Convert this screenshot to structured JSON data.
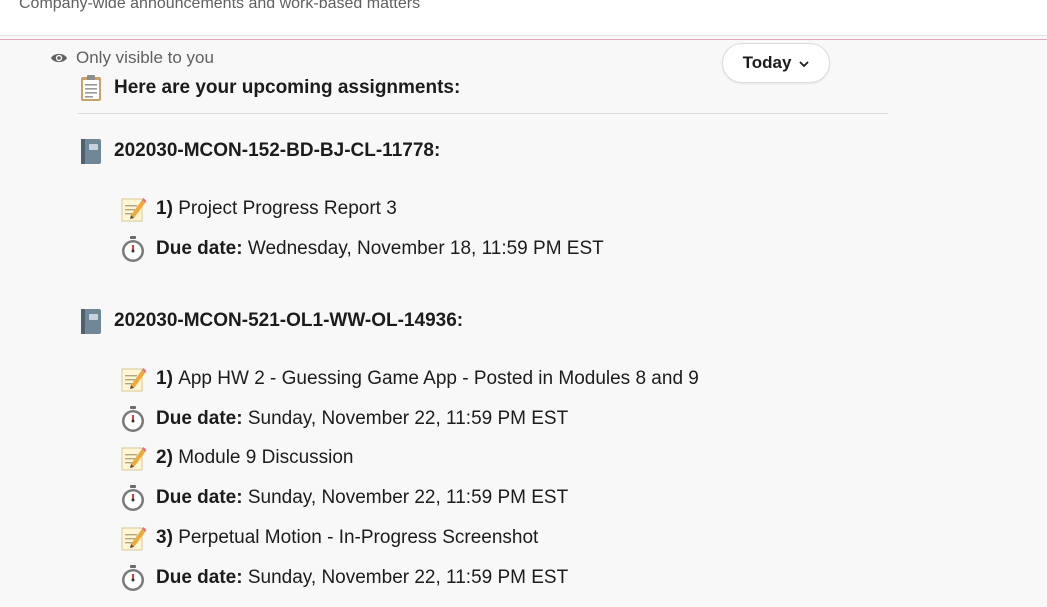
{
  "channel": {
    "description": "Company-wide announcements and work-based matters"
  },
  "message": {
    "visibility_label": "Only visible to you",
    "date_label": "Today",
    "heading": "Here are your upcoming assignments:"
  },
  "courses": [
    {
      "name": "202030-MCON-152-BD-BJ-CL-11778:",
      "assignments": [
        {
          "number": "1)",
          "title": "Project Progress Report 3",
          "due_label": "Due date:",
          "due": "Wednesday, November 18, 11:59 PM EST"
        }
      ]
    },
    {
      "name": "202030-MCON-521-OL1-WW-OL-14936:",
      "assignments": [
        {
          "number": "1)",
          "title": "App HW 2 - Guessing Game App - Posted in Modules 8 and 9",
          "due_label": "Due date:",
          "due": "Sunday, November 22, 11:59 PM EST"
        },
        {
          "number": "2)",
          "title": "Module 9 Discussion",
          "due_label": "Due date:",
          "due": "Sunday, November 22, 11:59 PM EST"
        },
        {
          "number": "3)",
          "title": "Perpetual Motion - In-Progress Screenshot",
          "due_label": "Due date:",
          "due": "Sunday, November 22, 11:59 PM EST"
        }
      ]
    }
  ],
  "icons": {
    "visibility": "eye-icon",
    "heading": "clipboard-icon",
    "course": "notebook-icon",
    "assignment": "memo-icon",
    "due": "stopwatch-icon",
    "date_pill": "chevron-down-icon"
  },
  "colors": {
    "divider": "#e8a6bd",
    "background": "#f8f8f8",
    "text": "#1d1c1d",
    "muted": "#616061"
  }
}
